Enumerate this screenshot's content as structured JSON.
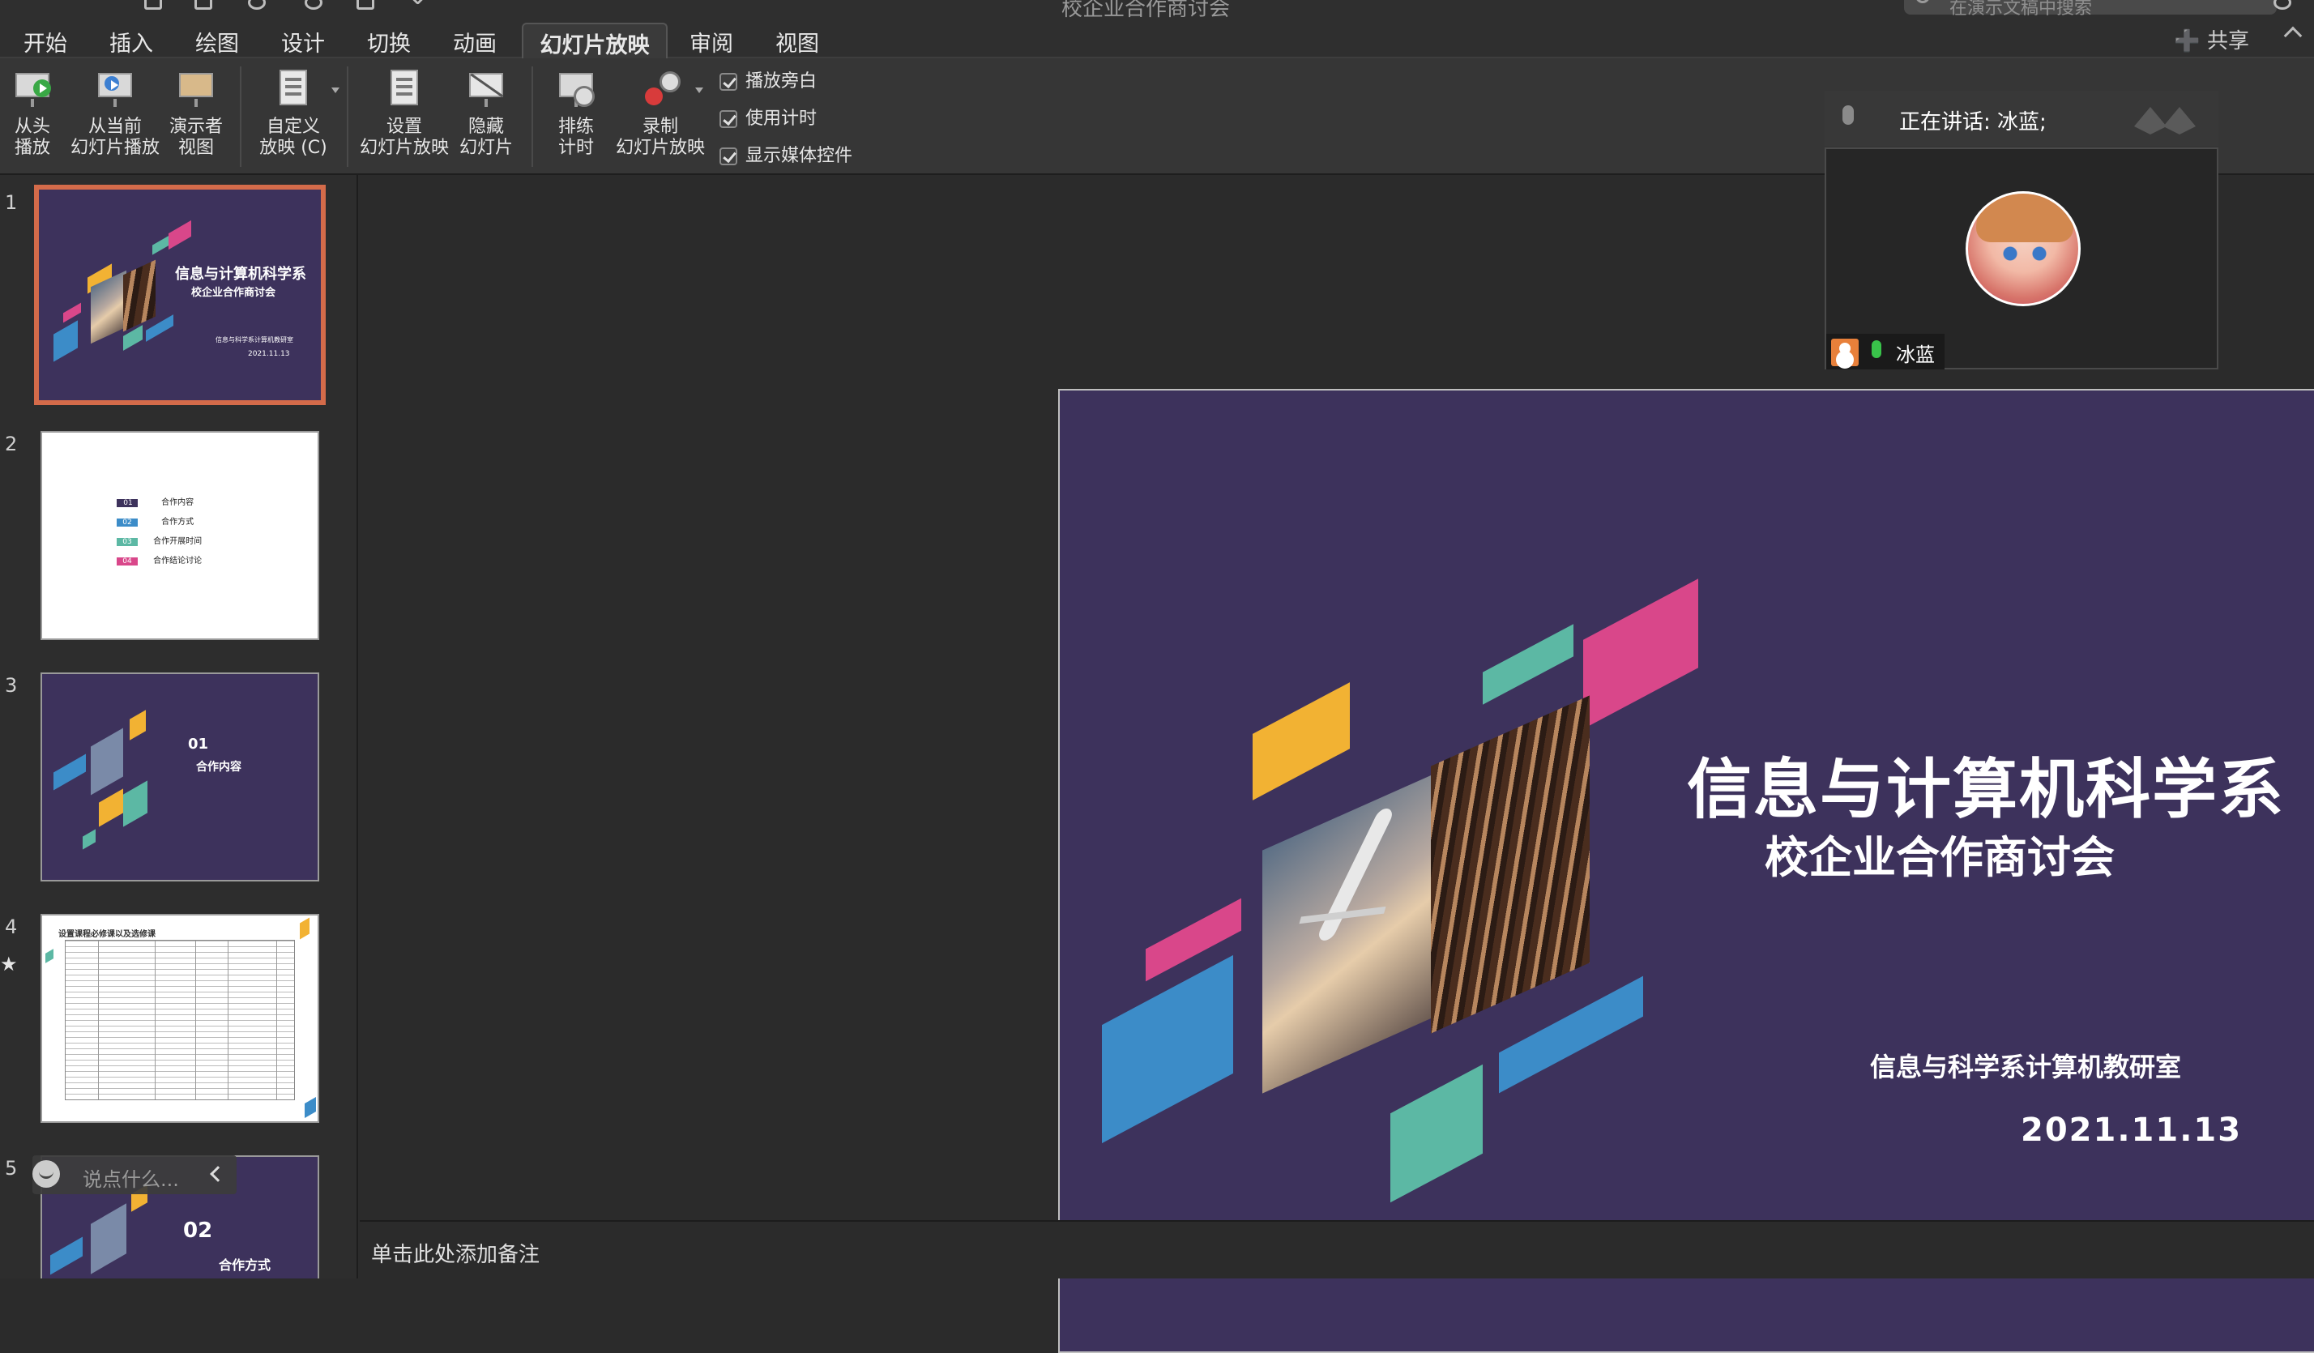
{
  "window": {
    "doc_title": "校企业合作商讨会",
    "search_placeholder": "在演示文稿中搜索"
  },
  "tabs": [
    "开始",
    "插入",
    "绘图",
    "设计",
    "切换",
    "动画",
    "幻灯片放映",
    "审阅",
    "视图"
  ],
  "active_tab": "幻灯片放映",
  "share_label": "共享",
  "ribbon": {
    "buttons": [
      {
        "label": "从头\n播放"
      },
      {
        "label": "从当前\n幻灯片播放"
      },
      {
        "label": "演示者\n视图"
      },
      {
        "label": "自定义\n放映 (C)"
      },
      {
        "label": "设置\n幻灯片放映"
      },
      {
        "label": "隐藏\n幻灯片"
      },
      {
        "label": "排练\n计时"
      },
      {
        "label": "录制\n幻灯片放映"
      }
    ],
    "checkboxes": [
      {
        "label": "播放旁白",
        "checked": true
      },
      {
        "label": "使用计时",
        "checked": true
      },
      {
        "label": "显示媒体控件",
        "checked": true
      }
    ]
  },
  "thumbnails": [
    {
      "number": "1",
      "title": "信息与计算机科学系",
      "subtitle": "校企业合作商讨会",
      "dept": "信息与科学系计算机教研室",
      "date": "2021.11.13"
    },
    {
      "number": "2",
      "items": [
        {
          "num": "01",
          "text": "合作内容",
          "color": "#3d325c"
        },
        {
          "num": "02",
          "text": "合作方式",
          "color": "#3c8cc8"
        },
        {
          "num": "03",
          "text": "合作开展时间",
          "color": "#5cb8a4"
        },
        {
          "num": "04",
          "text": "合作结论讨论",
          "color": "#d9478a"
        }
      ]
    },
    {
      "number": "3",
      "num_label": "01",
      "text": "合作内容"
    },
    {
      "number": "4",
      "title": "设置课程必修课以及选修课",
      "star": "★"
    },
    {
      "number": "5",
      "num_label": "02",
      "text": "合作方式"
    }
  ],
  "chat": {
    "placeholder": "说点什么..."
  },
  "slide": {
    "title": "信息与计算机科学系",
    "subtitle": "校企业合作商讨会",
    "dept": "信息与科学系计算机教研室",
    "date": "2021.11.13",
    "colors": {
      "background": "#3d325c",
      "pink": "#d9478a",
      "teal": "#5cb8a4",
      "yellow": "#f2b233",
      "blue": "#3c8cc8"
    }
  },
  "notes": {
    "placeholder": "单击此处添加备注"
  },
  "meeting": {
    "speaking_text": "正在讲话: 冰蓝;",
    "participant_name": "冰蓝"
  }
}
